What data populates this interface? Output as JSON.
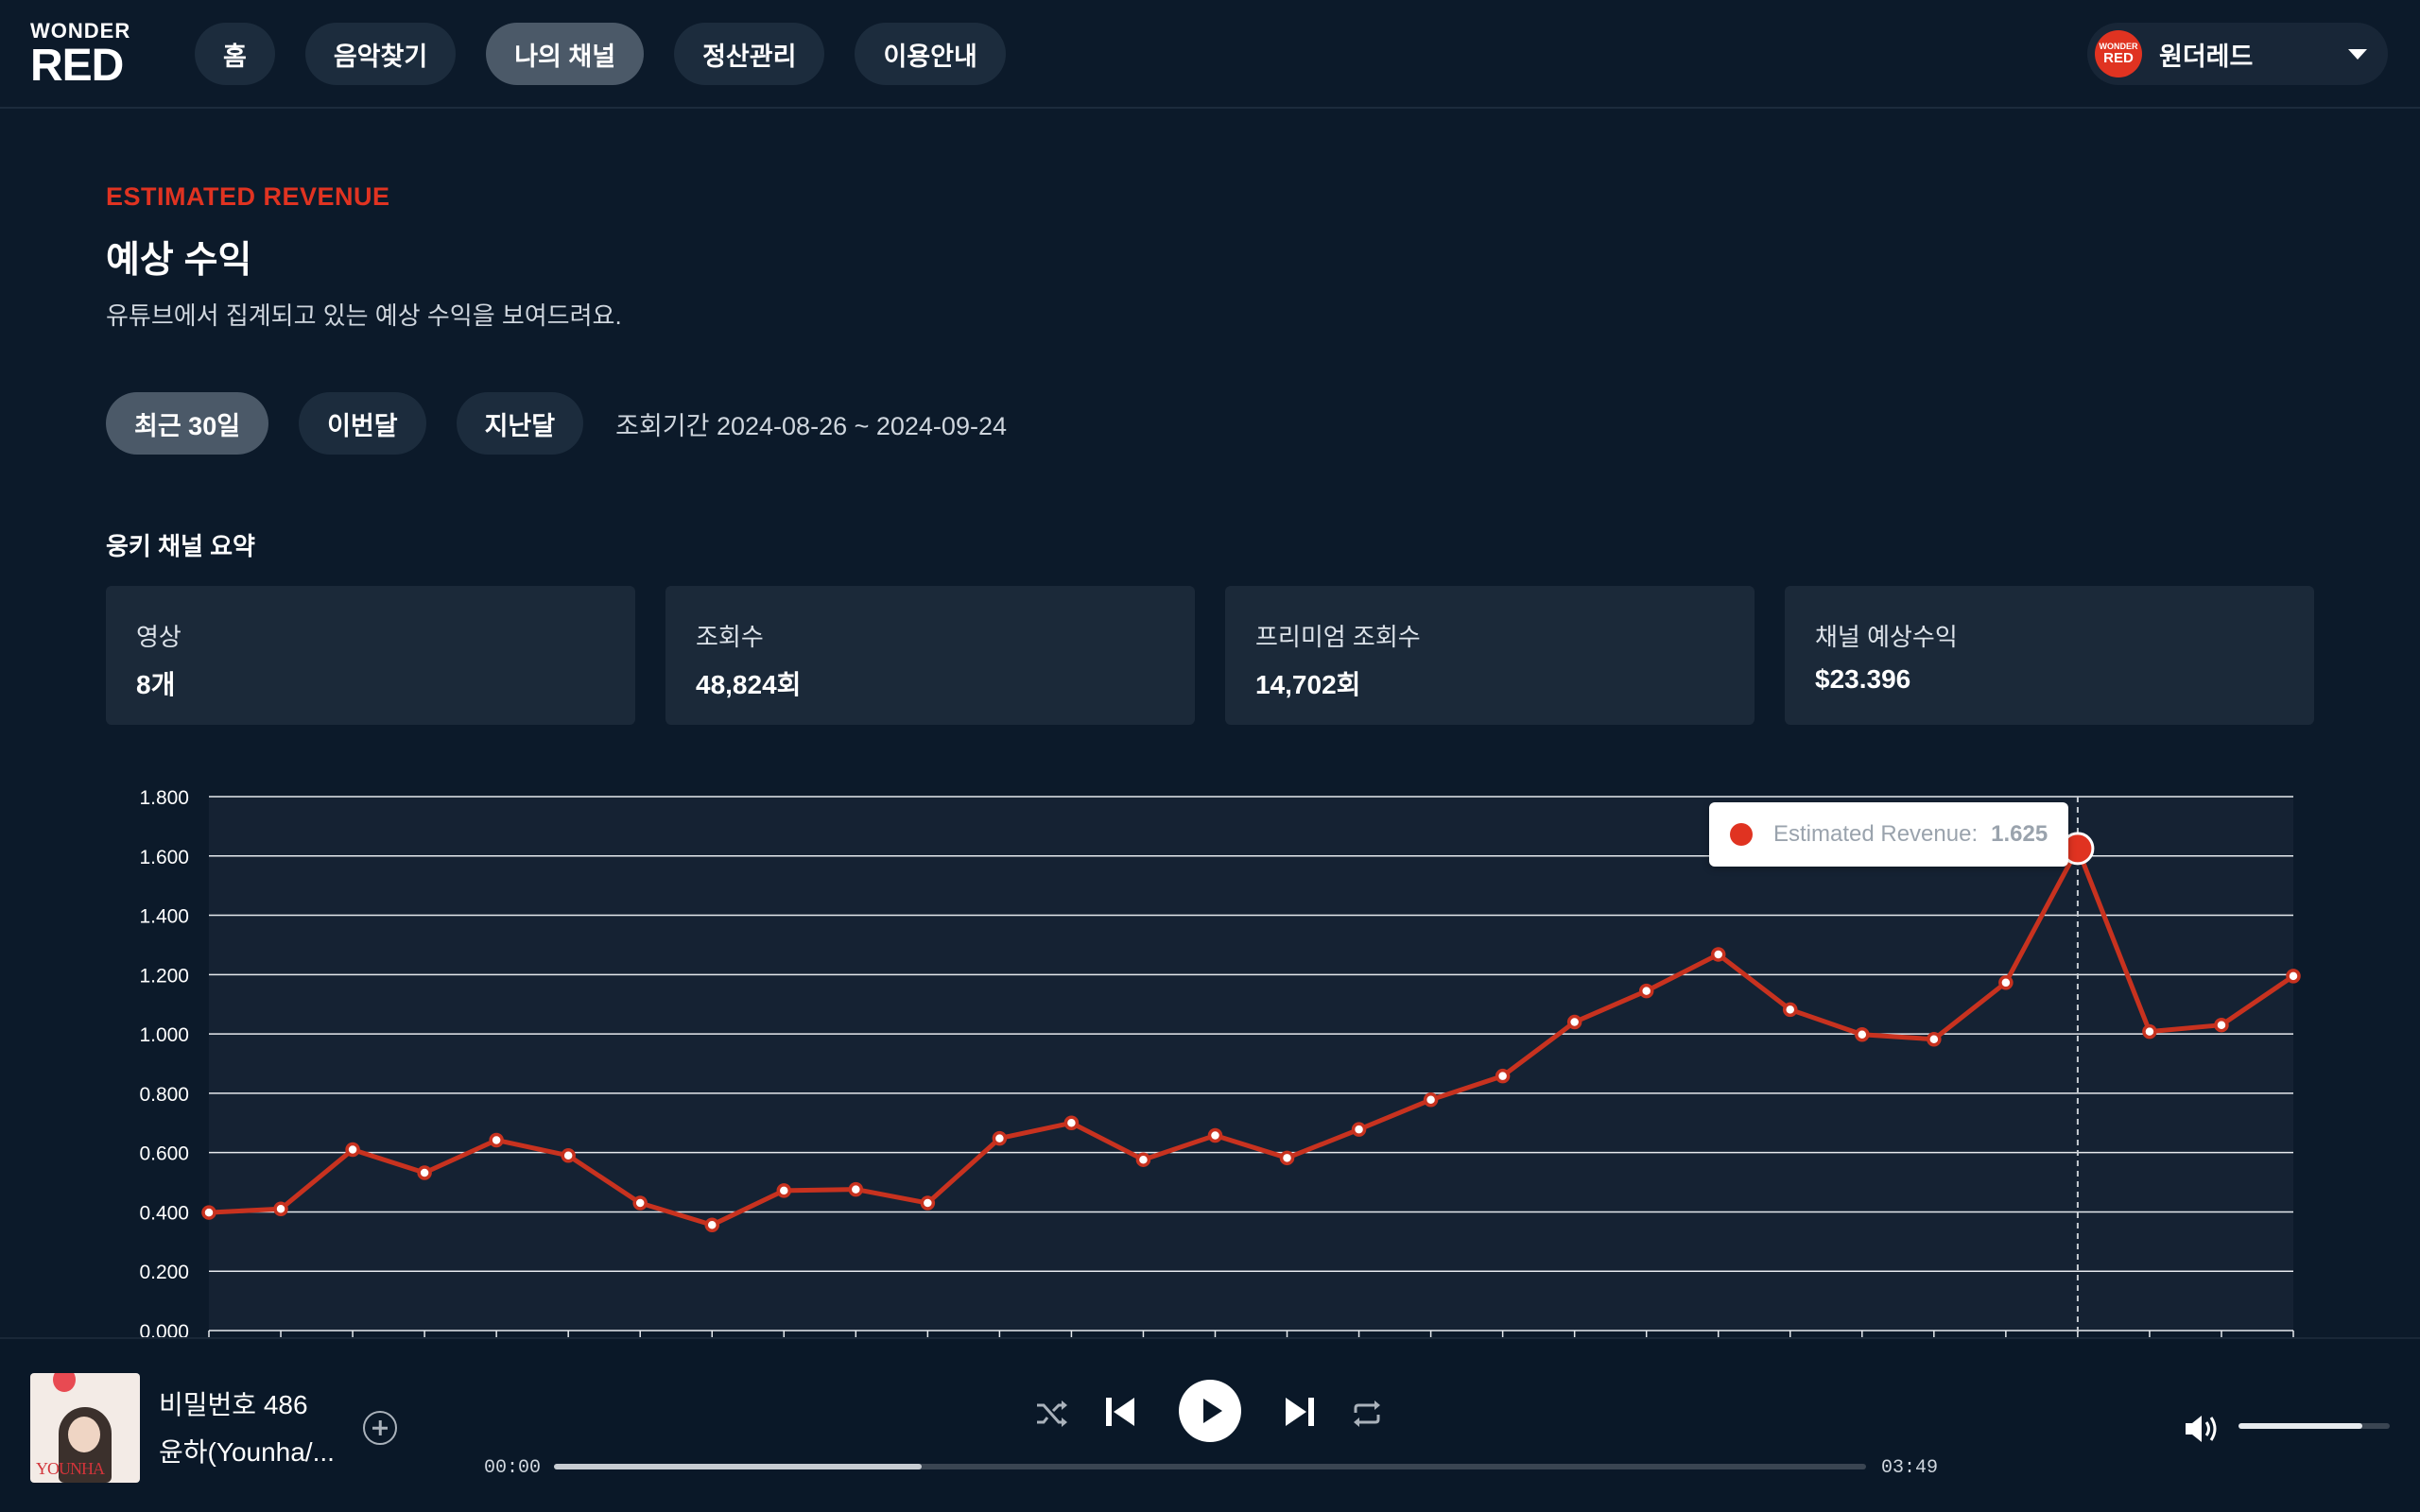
{
  "logo": {
    "line1": "WONDER",
    "line2": "RED"
  },
  "nav": [
    {
      "label": "홈",
      "active": false
    },
    {
      "label": "음악찾기",
      "active": false
    },
    {
      "label": "나의 채널",
      "active": true
    },
    {
      "label": "정산관리",
      "active": false
    },
    {
      "label": "이용안내",
      "active": false
    }
  ],
  "user": {
    "name": "원더레드",
    "avatar_top": "WONDER",
    "avatar_bottom": "RED"
  },
  "header": {
    "eyebrow": "ESTIMATED REVENUE",
    "title": "예상 수익",
    "description": "유튜브에서 집계되고 있는 예상 수익을 보여드려요."
  },
  "filters": {
    "buttons": [
      "최근 30일",
      "이번달",
      "지난달"
    ],
    "active_index": 0,
    "period": "조회기간 2024-08-26 ~ 2024-09-24"
  },
  "summary": {
    "title": "웅키 채널 요약",
    "cards": [
      {
        "label": "영상",
        "value": "8개"
      },
      {
        "label": "조회수",
        "value": "48,824회"
      },
      {
        "label": "프리미엄 조회수",
        "value": "14,702회"
      },
      {
        "label": "채널 예상수익",
        "value": "$23.396"
      }
    ]
  },
  "colors": {
    "background": "#0c1a2a",
    "accent": "#e03321",
    "line": "#c8321f",
    "card": "#1b2939"
  },
  "chart_data": {
    "type": "line",
    "series": [
      {
        "name": "Estimated Revenue",
        "values": [
          0.398,
          0.41,
          0.61,
          0.532,
          0.642,
          0.59,
          0.43,
          0.356,
          0.472,
          0.476,
          0.43,
          0.648,
          0.7,
          0.576,
          0.658,
          0.582,
          0.678,
          0.778,
          0.858,
          1.04,
          1.145,
          1.268,
          1.082,
          0.998,
          0.982,
          1.173,
          1.625,
          1.008,
          1.03,
          1.195
        ]
      }
    ],
    "ylim": [
      0,
      1.8
    ],
    "yticks": [
      "0.000",
      "0.200",
      "0.400",
      "0.600",
      "0.800",
      "1.000",
      "1.200",
      "1.400",
      "1.600",
      "1.800"
    ],
    "grid": true,
    "highlight_index": 26,
    "tooltip": {
      "label": "Estimated Revenue:",
      "value": "1.625"
    }
  },
  "player": {
    "title": "비밀번호 486",
    "artist": "윤하(Younha/...",
    "album_text": "YOUNHA",
    "current_time": "00:00",
    "duration": "03:49",
    "progress": 0.28,
    "volume": 0.82
  }
}
